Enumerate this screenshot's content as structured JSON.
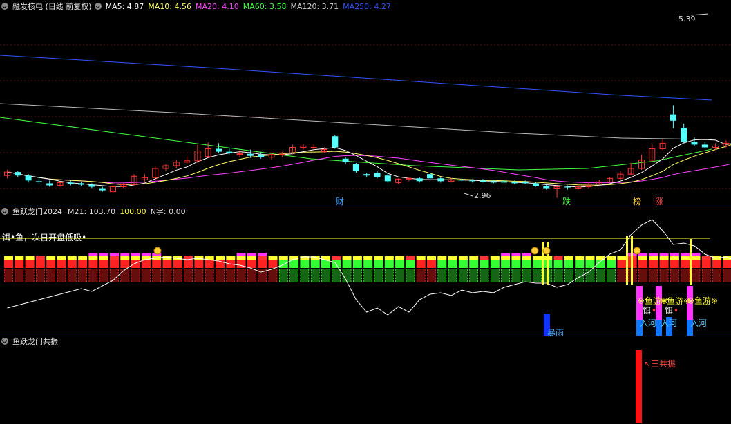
{
  "main_pane": {
    "title": "融发核电 (日线 前复权)",
    "ma_labels": [
      {
        "text": "MA5: 4.87",
        "color": "#ffffff"
      },
      {
        "text": "MA10: 4.56",
        "color": "#ffff66"
      },
      {
        "text": "MA20: 4.10",
        "color": "#ff44ff"
      },
      {
        "text": "MA60: 3.58",
        "color": "#44ff44"
      },
      {
        "text": "MA120: 3.71",
        "color": "#cccccc"
      },
      {
        "text": "MA250: 4.27",
        "color": "#3355ff"
      }
    ],
    "high_label": "5.39",
    "low_label": "2.96",
    "markers": [
      {
        "text": "财",
        "color": "#3399ff"
      },
      {
        "text": "跌",
        "color": "#44ff44"
      },
      {
        "text": "榜",
        "color": "#ffcc33"
      },
      {
        "text": "涨",
        "color": "#ff4444"
      }
    ]
  },
  "ind_pane": {
    "title": "鱼跃龙门2024",
    "values": [
      {
        "text": "M21: 103.70",
        "color": "#dddddd"
      },
      {
        "text": "100.00",
        "color": "#ffff33"
      },
      {
        "text": "N字: 0.00",
        "color": "#dddddd"
      }
    ],
    "bait_text": "饵•鱼，次日开盘低吸•",
    "tags": {
      "baoyu": "暴雨",
      "yuyou": "※鱼游※",
      "er": "饵",
      "dot": "•",
      "ruhe": "入河"
    }
  },
  "res_pane": {
    "title": "鱼跃龙门共振",
    "label": "↖三共振"
  },
  "colors": {
    "up": "#ff3333",
    "down": "#54ffff",
    "grid": "#5a1010",
    "ma5": "#ffffff",
    "ma10": "#ffff66",
    "ma20": "#ff44ff",
    "ma60": "#44ff44",
    "ma120": "#bbbbbb",
    "ma250": "#3355ff"
  },
  "chart_data": {
    "type": "candlestick",
    "price_range": [
      2.85,
      5.6
    ],
    "candles": [
      [
        3.28,
        3.36,
        3.24,
        3.33
      ],
      [
        3.33,
        3.34,
        3.26,
        3.28
      ],
      [
        3.28,
        3.3,
        3.18,
        3.21
      ],
      [
        3.2,
        3.25,
        3.16,
        3.19
      ],
      [
        3.17,
        3.21,
        3.12,
        3.14
      ],
      [
        3.14,
        3.2,
        3.12,
        3.18
      ],
      [
        3.18,
        3.21,
        3.14,
        3.16
      ],
      [
        3.17,
        3.19,
        3.13,
        3.15
      ],
      [
        3.15,
        3.17,
        3.1,
        3.12
      ],
      [
        3.1,
        3.12,
        3.05,
        3.07
      ],
      [
        3.05,
        3.14,
        3.03,
        3.12
      ],
      [
        3.12,
        3.17,
        3.1,
        3.15
      ],
      [
        3.15,
        3.3,
        3.14,
        3.27
      ],
      [
        3.22,
        3.3,
        3.18,
        3.25
      ],
      [
        3.25,
        3.42,
        3.22,
        3.38
      ],
      [
        3.38,
        3.44,
        3.34,
        3.42
      ],
      [
        3.42,
        3.5,
        3.38,
        3.47
      ],
      [
        3.47,
        3.55,
        3.44,
        3.49
      ],
      [
        3.49,
        3.72,
        3.46,
        3.63
      ],
      [
        3.55,
        3.75,
        3.53,
        3.66
      ],
      [
        3.66,
        3.74,
        3.6,
        3.62
      ],
      [
        3.62,
        3.67,
        3.58,
        3.6
      ],
      [
        3.58,
        3.64,
        3.54,
        3.59
      ],
      [
        3.59,
        3.65,
        3.53,
        3.56
      ],
      [
        3.58,
        3.62,
        3.52,
        3.54
      ],
      [
        3.54,
        3.61,
        3.51,
        3.58
      ],
      [
        3.58,
        3.62,
        3.54,
        3.6
      ],
      [
        3.6,
        3.72,
        3.58,
        3.68
      ],
      [
        3.68,
        3.73,
        3.65,
        3.7
      ],
      [
        3.67,
        3.72,
        3.65,
        3.68
      ],
      [
        3.62,
        3.68,
        3.6,
        3.65
      ],
      [
        3.84,
        3.86,
        3.66,
        3.68
      ],
      [
        3.52,
        3.54,
        3.44,
        3.47
      ],
      [
        3.44,
        3.46,
        3.32,
        3.34
      ],
      [
        3.3,
        3.32,
        3.26,
        3.28
      ],
      [
        3.32,
        3.34,
        3.24,
        3.26
      ],
      [
        3.28,
        3.31,
        3.18,
        3.2
      ],
      [
        3.18,
        3.24,
        3.16,
        3.23
      ],
      [
        3.23,
        3.25,
        3.2,
        3.24
      ],
      [
        3.24,
        3.26,
        3.18,
        3.2
      ],
      [
        3.3,
        3.32,
        3.22,
        3.24
      ],
      [
        3.24,
        3.26,
        3.18,
        3.2
      ],
      [
        3.2,
        3.24,
        3.18,
        3.22
      ],
      [
        3.22,
        3.24,
        3.19,
        3.21
      ],
      [
        3.21,
        3.23,
        3.18,
        3.2
      ],
      [
        3.21,
        3.23,
        3.18,
        3.19
      ],
      [
        3.2,
        3.22,
        3.17,
        3.18
      ],
      [
        3.2,
        3.21,
        3.17,
        3.18
      ],
      [
        3.19,
        3.21,
        3.16,
        3.17
      ],
      [
        3.19,
        3.21,
        3.16,
        3.17
      ],
      [
        3.17,
        3.18,
        3.12,
        3.13
      ],
      [
        3.13,
        3.16,
        3.08,
        3.1
      ],
      [
        3.1,
        3.13,
        2.96,
        3.12
      ],
      [
        3.12,
        3.14,
        3.08,
        3.11
      ],
      [
        3.1,
        3.13,
        3.08,
        3.12
      ],
      [
        3.12,
        3.18,
        3.1,
        3.16
      ],
      [
        3.16,
        3.22,
        3.14,
        3.19
      ],
      [
        3.19,
        3.26,
        3.17,
        3.24
      ],
      [
        3.24,
        3.34,
        3.22,
        3.3
      ],
      [
        3.3,
        3.46,
        3.28,
        3.38
      ],
      [
        3.38,
        3.58,
        3.36,
        3.5
      ],
      [
        3.5,
        3.74,
        3.48,
        3.66
      ],
      [
        3.66,
        3.8,
        3.64,
        3.74
      ],
      [
        4.15,
        4.28,
        3.95,
        4.06
      ],
      [
        3.96,
        4.02,
        3.74,
        3.76
      ],
      [
        3.76,
        3.82,
        3.7,
        3.72
      ],
      [
        3.72,
        3.76,
        3.66,
        3.68
      ],
      [
        3.68,
        3.74,
        3.64,
        3.7
      ],
      [
        3.7,
        3.78,
        3.68,
        3.74
      ],
      [
        3.74,
        3.96,
        3.72,
        3.92
      ],
      [
        3.92,
        4.16,
        3.88,
        4.12
      ],
      [
        4.12,
        4.44,
        4.08,
        4.38
      ],
      [
        4.38,
        4.48,
        4.26,
        4.34
      ],
      [
        4.4,
        4.55,
        4.36,
        4.52
      ],
      [
        4.52,
        4.78,
        4.48,
        4.74
      ],
      [
        4.74,
        4.9,
        4.7,
        4.8
      ],
      [
        4.8,
        5.1,
        4.72,
        5.02
      ],
      [
        5.22,
        5.32,
        4.92,
        4.98
      ],
      [
        4.84,
        4.96,
        4.76,
        4.92
      ],
      [
        4.9,
        5.15,
        4.85,
        5.12
      ],
      [
        5.08,
        5.36,
        5.05,
        5.28
      ],
      [
        5.3,
        5.39,
        5.13,
        5.16
      ]
    ]
  }
}
